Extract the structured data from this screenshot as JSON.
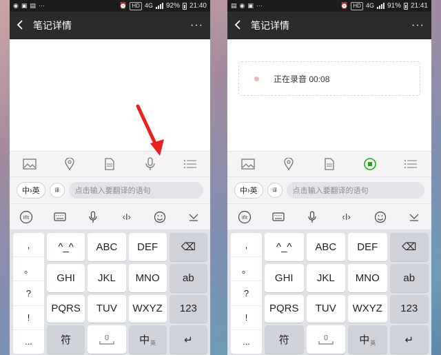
{
  "left": {
    "status": {
      "time": "21:40",
      "battery": "92%",
      "network": "4G",
      "hd": "HD"
    },
    "title": "笔记详情",
    "more": "···",
    "keyboard_toggle": "中›英",
    "trans_badge": "译",
    "trans_placeholder": "点击输入要翻译的语句"
  },
  "right": {
    "status": {
      "time": "21:41",
      "battery": "91%",
      "network": "4G",
      "hd": "HD"
    },
    "title": "笔记详情",
    "more": "···",
    "recording_text": "正在录音 00:08",
    "keyboard_toggle": "中›英",
    "trans_badge": "译",
    "trans_placeholder": "点击输入要翻译的语句"
  },
  "keyboard": {
    "punct": [
      ",",
      "。",
      "?",
      "!",
      "..."
    ],
    "keys": [
      "^_^",
      "ABC",
      "DEF",
      "⌫",
      "GHI",
      "JKL",
      "MNO",
      "ab",
      "PQRS",
      "TUV",
      "WXYZ",
      "123",
      "符",
      "",
      "中",
      "↵"
    ],
    "key_sub_en": "英"
  },
  "colors": {
    "accent_green": "#1aad19",
    "arrow_red": "#e8231e",
    "titlebar": "#2b2b2b"
  }
}
